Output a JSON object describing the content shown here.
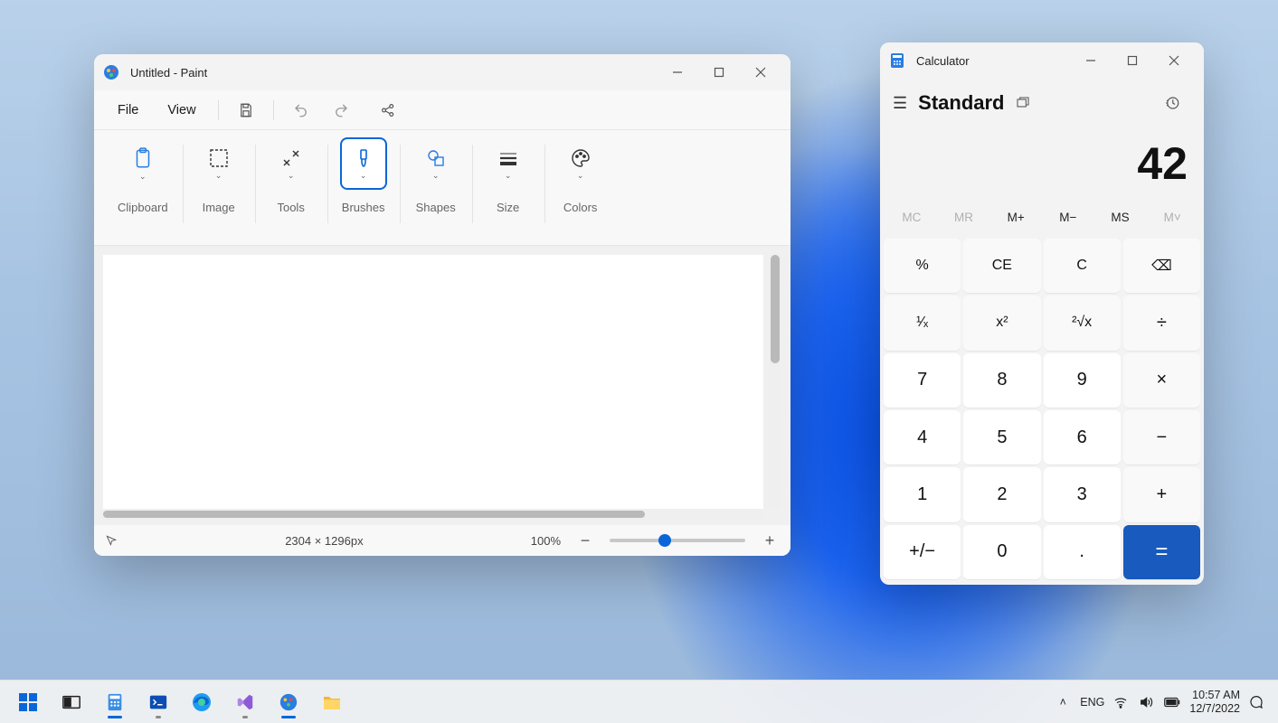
{
  "paint": {
    "title": "Untitled - Paint",
    "menu": {
      "file": "File",
      "view": "View"
    },
    "ribbon": {
      "clipboard": "Clipboard",
      "image": "Image",
      "tools": "Tools",
      "brushes": "Brushes",
      "shapes": "Shapes",
      "size": "Size",
      "colors": "Colors"
    },
    "status": {
      "dimensions": "2304 × 1296px",
      "zoom": "100%"
    }
  },
  "calculator": {
    "title": "Calculator",
    "mode": "Standard",
    "display": "42",
    "memory": {
      "mc": "MC",
      "mr": "MR",
      "mplus": "M+",
      "mminus": "M−",
      "ms": "MS",
      "mv": "M˅"
    },
    "keys": {
      "percent": "%",
      "ce": "CE",
      "c": "C",
      "back": "⌫",
      "recip": "¹⁄ₓ",
      "sq": "x²",
      "sqrt": "²√x",
      "div": "÷",
      "k7": "7",
      "k8": "8",
      "k9": "9",
      "mul": "×",
      "k4": "4",
      "k5": "5",
      "k6": "6",
      "sub": "−",
      "k1": "1",
      "k2": "2",
      "k3": "3",
      "add": "+",
      "neg": "+/−",
      "k0": "0",
      "dot": ".",
      "eq": "="
    }
  },
  "taskbar": {
    "lang": "ENG",
    "time": "10:57 AM",
    "date": "12/7/2022"
  }
}
